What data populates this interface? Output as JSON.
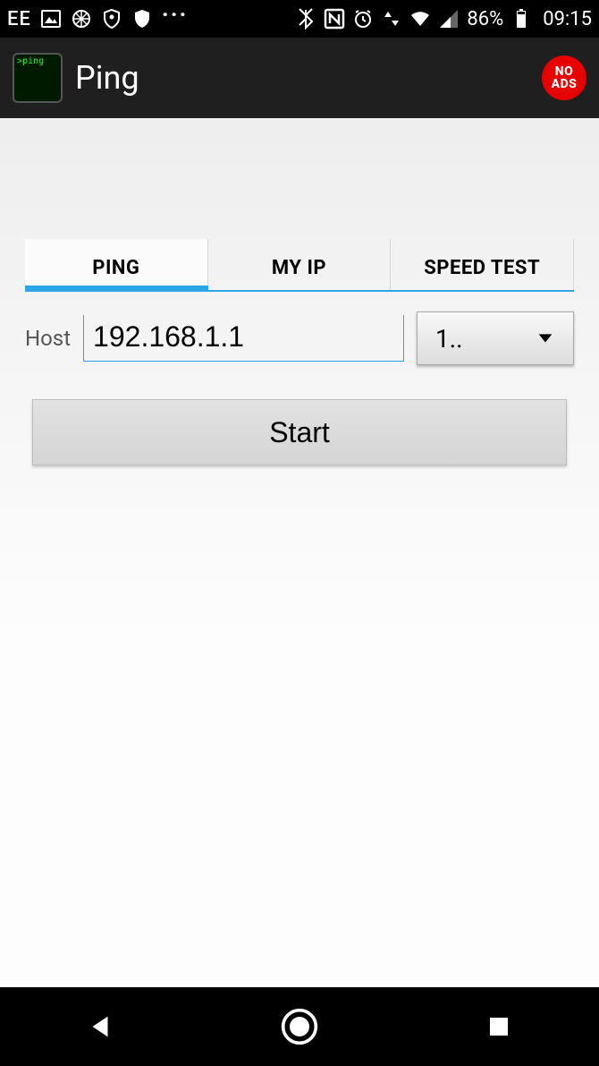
{
  "status_bar": {
    "carrier": "EE",
    "battery_percent": "86%",
    "clock": "09:15"
  },
  "app_bar": {
    "title": "Ping",
    "no_ads_line1": "NO",
    "no_ads_line2": "ADS"
  },
  "tabs": [
    {
      "label": "PING",
      "active": true
    },
    {
      "label": "MY IP",
      "active": false
    },
    {
      "label": "SPEED TEST",
      "active": false
    }
  ],
  "form": {
    "host_label": "Host",
    "host_value": "192.168.1.1",
    "count_selected": "1..",
    "start_label": "Start"
  }
}
